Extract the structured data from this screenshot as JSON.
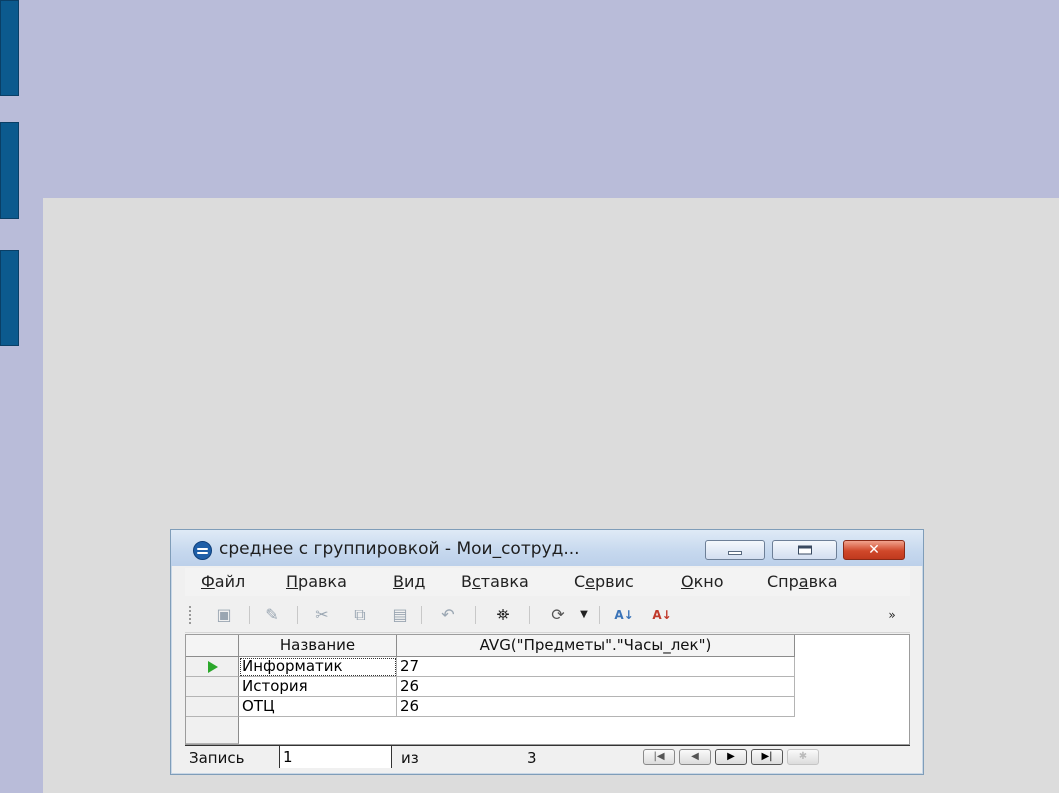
{
  "window": {
    "title": "среднее с группировкой - Мои_сотруд...",
    "close_glyph": "✕"
  },
  "menu": [
    {
      "pre": "",
      "u": "Ф",
      "post": "айл"
    },
    {
      "pre": "",
      "u": "П",
      "post": "равка"
    },
    {
      "pre": "",
      "u": "В",
      "post": "ид"
    },
    {
      "pre": "В",
      "u": "с",
      "post": "тавка"
    },
    {
      "pre": "С",
      "u": "е",
      "post": "рвис"
    },
    {
      "pre": "",
      "u": "О",
      "post": "кно"
    },
    {
      "pre": "Спр",
      "u": "а",
      "post": "вка"
    }
  ],
  "toolbar": {
    "icons": [
      "save-icon",
      "edit-icon",
      "cut-icon",
      "copy-icon",
      "paste-icon",
      "undo-icon",
      "find-icon",
      "refresh-icon",
      "sort-ascending-icon",
      "sort-descending-icon"
    ],
    "overflow": "»"
  },
  "grid": {
    "columns": [
      "Название",
      "AVG(\"Предметы\".\"Часы_лек\")"
    ],
    "rows": [
      [
        "Информатик",
        "27"
      ],
      [
        "История",
        "26"
      ],
      [
        "ОТЦ",
        "26"
      ]
    ]
  },
  "nav": {
    "record_label": "Запись",
    "record_value": "1",
    "of_label": "из",
    "total": "3",
    "buttons": [
      "first-record-button",
      "prev-record-button",
      "next-record-button",
      "last-record-button",
      "new-record-button"
    ]
  }
}
